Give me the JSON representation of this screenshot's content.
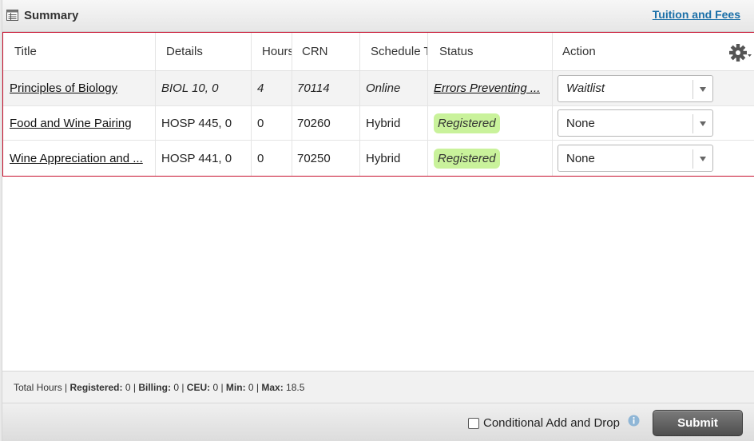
{
  "header": {
    "title": "Summary",
    "summary_icon": "table-icon",
    "tuition_link": "Tuition and Fees"
  },
  "grid": {
    "columns": [
      "Title",
      "Details",
      "Hours",
      "CRN",
      "Schedule T",
      "Status",
      "Action"
    ],
    "settings_icon": "gear-icon",
    "rows": [
      {
        "title": "Principles of Biology",
        "details": "BIOL 10, 0",
        "hours": "4",
        "crn": "70114",
        "schedule": "Online",
        "status": "Errors Preventing ...",
        "action": "Waitlist"
      },
      {
        "title": "Food and Wine Pairing",
        "details": "HOSP 445, 0",
        "hours": "0",
        "crn": "70260",
        "schedule": "Hybrid",
        "status": "Registered",
        "action": "None"
      },
      {
        "title": "Wine Appreciation and ...",
        "details": "HOSP 441, 0",
        "hours": "0",
        "crn": "70250",
        "schedule": "Hybrid",
        "status": "Registered",
        "action": "None"
      }
    ]
  },
  "totals": {
    "prefix": "Total Hours | ",
    "registered_label": "Registered:",
    "registered_value": " 0 | ",
    "billing_label": "Billing:",
    "billing_value": " 0 | ",
    "ceu_label": "CEU:",
    "ceu_value": " 0 | ",
    "min_label": "Min:",
    "min_value": " 0 | ",
    "max_label": "Max:",
    "max_value": " 18.5"
  },
  "bottom": {
    "conditional_label": "Conditional Add and Drop",
    "conditional_checked": false,
    "info_icon": "info-icon",
    "submit_label": "Submit"
  },
  "colors": {
    "registered_badge": "#c9f29b",
    "grid_border": "#c8102e",
    "link": "#1a6fa8",
    "submit_button": "#5e5e5e"
  }
}
